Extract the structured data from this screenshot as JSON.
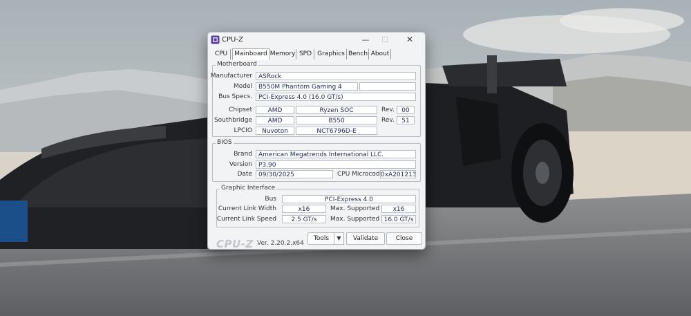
{
  "window": {
    "title": "CPU-Z",
    "minimize_symbol": "—",
    "maximize_symbol": "☐",
    "close_symbol": "✕"
  },
  "tabs": [
    {
      "label": "CPU"
    },
    {
      "label": "Mainboard",
      "active": true
    },
    {
      "label": "Memory"
    },
    {
      "label": "SPD"
    },
    {
      "label": "Graphics"
    },
    {
      "label": "Bench"
    },
    {
      "label": "About"
    }
  ],
  "motherboard": {
    "legend": "Motherboard",
    "manufacturer_label": "Manufacturer",
    "manufacturer": "ASRock",
    "model_label": "Model",
    "model": "B550M Phantom Gaming 4",
    "bus_label": "Bus Specs.",
    "bus": "PCI-Express 4.0 (16.0 GT/s)",
    "chipset_label": "Chipset",
    "chipset_vendor": "AMD",
    "chipset_model": "Ryzen SOC",
    "chipset_rev_label": "Rev.",
    "chipset_rev": "00",
    "southbridge_label": "Southbridge",
    "southbridge_vendor": "AMD",
    "southbridge_model": "B550",
    "southbridge_rev_label": "Rev.",
    "southbridge_rev": "51",
    "lpcio_label": "LPCIO",
    "lpcio_vendor": "Nuvoton",
    "lpcio_model": "NCT6796D-E"
  },
  "bios": {
    "legend": "BIOS",
    "brand_label": "Brand",
    "brand": "American Megatrends International LLC.",
    "version_label": "Version",
    "version": "P3.90",
    "date_label": "Date",
    "date": "09/30/2025",
    "microcode_label": "CPU Microcode",
    "microcode": "0xA201213"
  },
  "graphic_interface": {
    "legend": "Graphic Interface",
    "bus_label": "Bus",
    "bus": "PCI-Express 4.0",
    "link_width_label": "Current Link Width",
    "link_width": "x16",
    "max_width_label": "Max. Supported",
    "max_width": "x16",
    "link_speed_label": "Current Link Speed",
    "link_speed": "2.5 GT/s",
    "max_speed_label": "Max. Supported",
    "max_speed": "16.0 GT/s"
  },
  "footer": {
    "logo": "CPU-Z",
    "version": "Ver. 2.20.2.x64",
    "tools_label": "Tools",
    "tools_arrow": "▼",
    "validate_label": "Validate",
    "close_label": "Close"
  }
}
